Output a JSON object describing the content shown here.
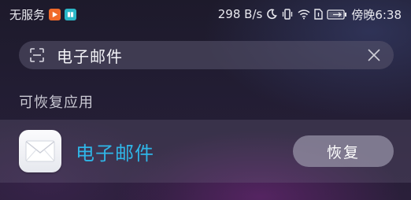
{
  "status_bar": {
    "carrier": "无服务",
    "network_speed": "298 B/s",
    "time": "傍晚6:38",
    "icons": [
      "do-not-disturb-moon-icon",
      "vibrate-icon",
      "wifi-icon",
      "sim-icon",
      "battery-icon"
    ]
  },
  "search": {
    "query": "电子邮件",
    "icons": [
      "scan-icon",
      "clear-icon"
    ]
  },
  "section": {
    "title": "可恢复应用"
  },
  "app_row": {
    "name": "电子邮件",
    "icon": "email-envelope-icon",
    "name_color": "#2fb6e8",
    "button_label": "恢复"
  }
}
